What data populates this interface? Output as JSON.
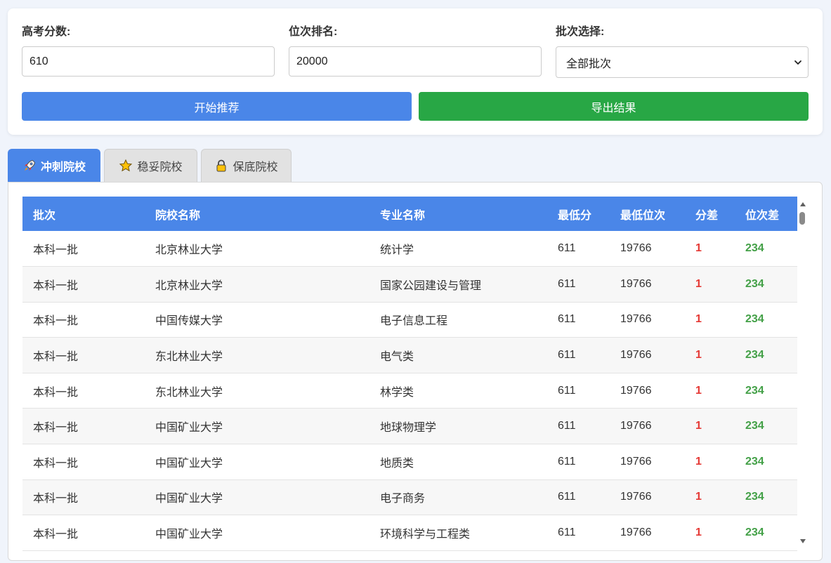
{
  "form": {
    "score_label": "高考分数:",
    "score_value": "610",
    "rank_label": "位次排名:",
    "rank_value": "20000",
    "batch_label": "批次选择:",
    "batch_selected": "全部批次",
    "recommend_button": "开始推荐",
    "export_button": "导出结果"
  },
  "tabs": [
    {
      "label": "冲刺院校",
      "icon": "rocket-icon",
      "active": true
    },
    {
      "label": "稳妥院校",
      "icon": "star-icon",
      "active": false
    },
    {
      "label": "保底院校",
      "icon": "lock-icon",
      "active": false
    }
  ],
  "table": {
    "headers": [
      "批次",
      "院校名称",
      "专业名称",
      "最低分",
      "最低位次",
      "分差",
      "位次差"
    ],
    "rows": [
      [
        "本科一批",
        "北京林业大学",
        "统计学",
        "611",
        "19766",
        "1",
        "234"
      ],
      [
        "本科一批",
        "北京林业大学",
        "国家公园建设与管理",
        "611",
        "19766",
        "1",
        "234"
      ],
      [
        "本科一批",
        "中国传媒大学",
        "电子信息工程",
        "611",
        "19766",
        "1",
        "234"
      ],
      [
        "本科一批",
        "东北林业大学",
        "电气类",
        "611",
        "19766",
        "1",
        "234"
      ],
      [
        "本科一批",
        "东北林业大学",
        "林学类",
        "611",
        "19766",
        "1",
        "234"
      ],
      [
        "本科一批",
        "中国矿业大学",
        "地球物理学",
        "611",
        "19766",
        "1",
        "234"
      ],
      [
        "本科一批",
        "中国矿业大学",
        "地质类",
        "611",
        "19766",
        "1",
        "234"
      ],
      [
        "本科一批",
        "中国矿业大学",
        "电子商务",
        "611",
        "19766",
        "1",
        "234"
      ],
      [
        "本科一批",
        "中国矿业大学",
        "环境科学与工程类",
        "611",
        "19766",
        "1",
        "234"
      ]
    ]
  },
  "colors": {
    "primary": "#4a86e8",
    "success": "#28a745",
    "diff_score": "#e53935",
    "diff_rank": "#43a047"
  }
}
